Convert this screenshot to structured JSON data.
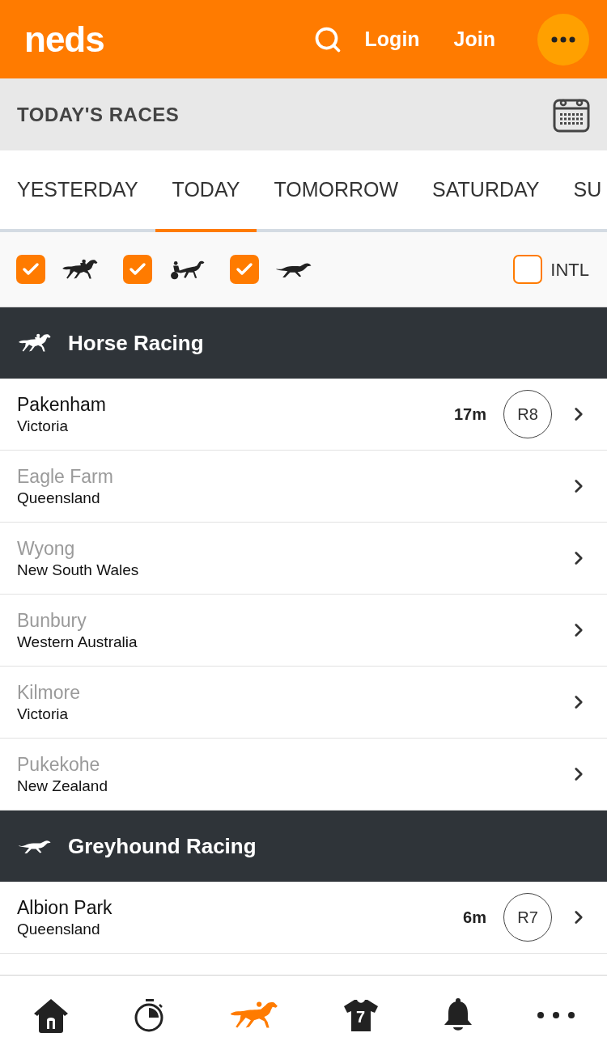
{
  "header": {
    "logo": "neds",
    "actions": [
      "Login",
      "Join"
    ]
  },
  "page_title": "TODAY'S RACES",
  "day_tabs": [
    {
      "label": "YESTERDAY",
      "selected": false
    },
    {
      "label": "TODAY",
      "selected": true
    },
    {
      "label": "TOMORROW",
      "selected": false
    },
    {
      "label": "SATURDAY",
      "selected": false
    },
    {
      "label": "SU",
      "selected": false
    }
  ],
  "filters": [
    {
      "kind": "horse",
      "checked": true
    },
    {
      "kind": "harness",
      "checked": true
    },
    {
      "kind": "greyhound",
      "checked": true
    }
  ],
  "intl_filter": {
    "label": "INTL",
    "checked": false
  },
  "sections": [
    {
      "kind": "horse",
      "title": "Horse Racing",
      "meetings": [
        {
          "venue": "Pakenham",
          "region": "Victoria",
          "dimmed": false,
          "time": "17m",
          "race": "R8"
        },
        {
          "venue": "Eagle Farm",
          "region": "Queensland",
          "dimmed": true
        },
        {
          "venue": "Wyong",
          "region": "New South Wales",
          "dimmed": true
        },
        {
          "venue": "Bunbury",
          "region": "Western Australia",
          "dimmed": true
        },
        {
          "venue": "Kilmore",
          "region": "Victoria",
          "dimmed": true
        },
        {
          "venue": "Pukekohe",
          "region": "New Zealand",
          "dimmed": true
        }
      ]
    },
    {
      "kind": "greyhound",
      "title": "Greyhound Racing",
      "meetings": [
        {
          "venue": "Albion Park",
          "region": "Queensland",
          "dimmed": false,
          "time": "6m",
          "race": "R7"
        }
      ]
    }
  ],
  "bottom_nav": [
    {
      "kind": "home",
      "selected": false
    },
    {
      "kind": "timer",
      "selected": false
    },
    {
      "kind": "racing",
      "selected": true
    },
    {
      "kind": "sports",
      "selected": false,
      "badge": "7"
    },
    {
      "kind": "notifications",
      "selected": false
    },
    {
      "kind": "more",
      "selected": false
    }
  ]
}
